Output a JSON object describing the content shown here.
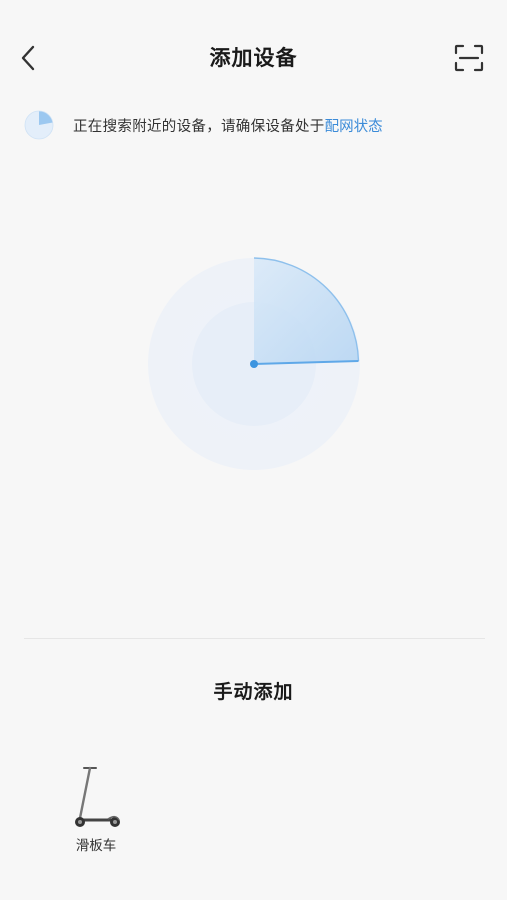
{
  "header": {
    "title": "添加设备",
    "back_icon": "chevron-left-icon",
    "scan_icon": "scan-icon"
  },
  "status": {
    "text": "正在搜索附近的设备，请确保设备处于",
    "link": "配网状态",
    "link_color": "#3b8bd8"
  },
  "radar": {
    "accent_color": "#5fa8e8"
  },
  "manual": {
    "title": "手动添加",
    "devices": [
      {
        "label": "滑板车",
        "icon": "scooter-icon"
      }
    ]
  }
}
